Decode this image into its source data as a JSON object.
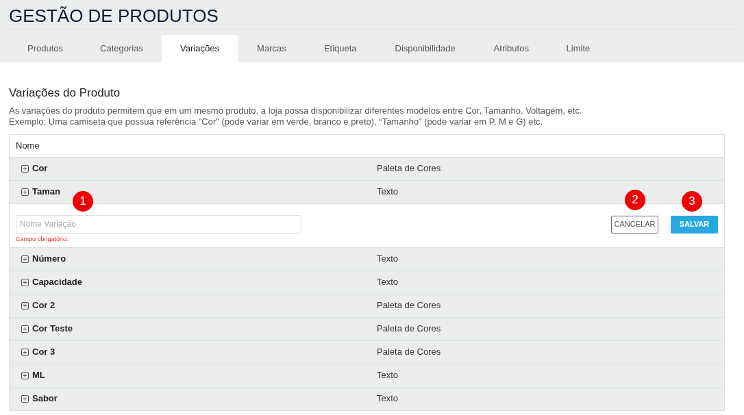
{
  "title": "GESTÃO DE PRODUTOS",
  "tabs": [
    {
      "label": "Produtos",
      "selected": false
    },
    {
      "label": "Categorias",
      "selected": false
    },
    {
      "label": "Variações",
      "selected": true
    },
    {
      "label": "Marcas",
      "selected": false
    },
    {
      "label": "Etiqueta",
      "selected": false
    },
    {
      "label": "Disponibilidade",
      "selected": false
    },
    {
      "label": "Atributos",
      "selected": false
    },
    {
      "label": "Limite",
      "selected": false
    }
  ],
  "section": {
    "heading": "Variações do Produto",
    "description": [
      "As variações do produto permitem que em um mesmo produto, a loja possa disponibilizar diferentes modelos entre Cor, Tamanho, Voltagem, etc.",
      "Exemplo: Uma camiseta que possua referência \"Cor\" (pode variar em verde, branco e preto), “Tamanho” (pode variar em P, M e G) etc."
    ]
  },
  "table": {
    "columns": [
      "Nome"
    ],
    "rows_before": [
      {
        "name": "Cor",
        "type": "Paleta de Cores"
      },
      {
        "name": "Taman",
        "type": "Texto"
      }
    ],
    "edit_row": {
      "placeholder": "Nome Variação",
      "error": "Campo obrigatório.",
      "cancel": "CANCELAR",
      "save": "SALVAR"
    },
    "rows_after": [
      {
        "name": "Número",
        "type": "Texto"
      },
      {
        "name": "Capacidade",
        "type": "Texto"
      },
      {
        "name": "Cor 2",
        "type": "Paleta de Cores"
      },
      {
        "name": "Cor Teste",
        "type": "Paleta de Cores"
      },
      {
        "name": "Cor 3",
        "type": "Paleta de Cores"
      },
      {
        "name": "ML",
        "type": "Texto"
      },
      {
        "name": "Sabor",
        "type": "Texto"
      }
    ]
  },
  "callouts": [
    "1",
    "2",
    "3"
  ]
}
